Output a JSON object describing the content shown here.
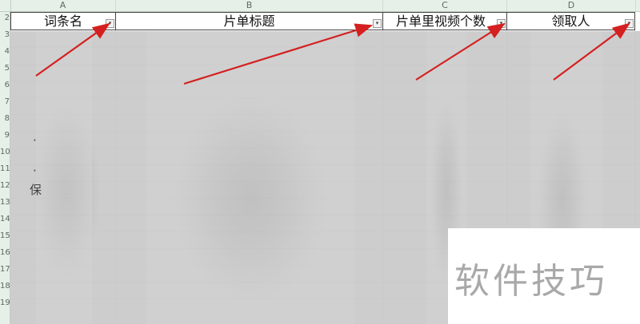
{
  "columns": [
    "A",
    "B",
    "C",
    "D"
  ],
  "row_numbers": [
    "2",
    "3",
    "4",
    "5",
    "6",
    "7",
    "8",
    "9",
    "10",
    "11",
    "12",
    "13",
    "14",
    "15",
    "16",
    "17",
    "18",
    "19"
  ],
  "headers": [
    "词条名",
    "片单标题",
    "片单里视频个数",
    "领取人"
  ],
  "dropdown_glyph": "▾",
  "ghost_text": [
    "·",
    "·",
    "保"
  ],
  "watermark": "软件技巧",
  "annotation_color": "#d42020"
}
